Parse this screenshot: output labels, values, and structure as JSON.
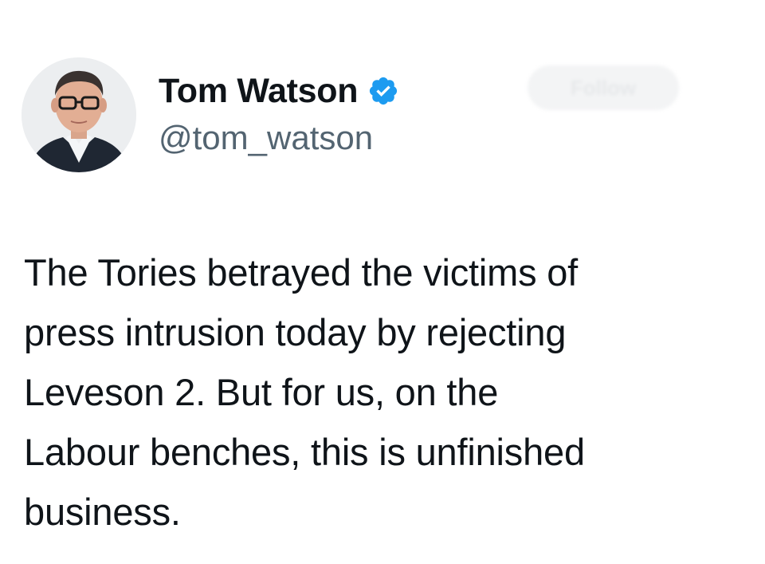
{
  "author": {
    "display_name": "Tom Watson",
    "handle": "@tom_watson",
    "verified_icon": "verified-check-icon",
    "badge_color": "#1d9bf0"
  },
  "follow_button": {
    "label": "Follow"
  },
  "tweet": {
    "lines": [
      "The Tories betrayed the victims of",
      "press intrusion today by rejecting",
      "Leveson 2. But for us, on the",
      "Labour benches, this is unfinished",
      "business."
    ]
  }
}
